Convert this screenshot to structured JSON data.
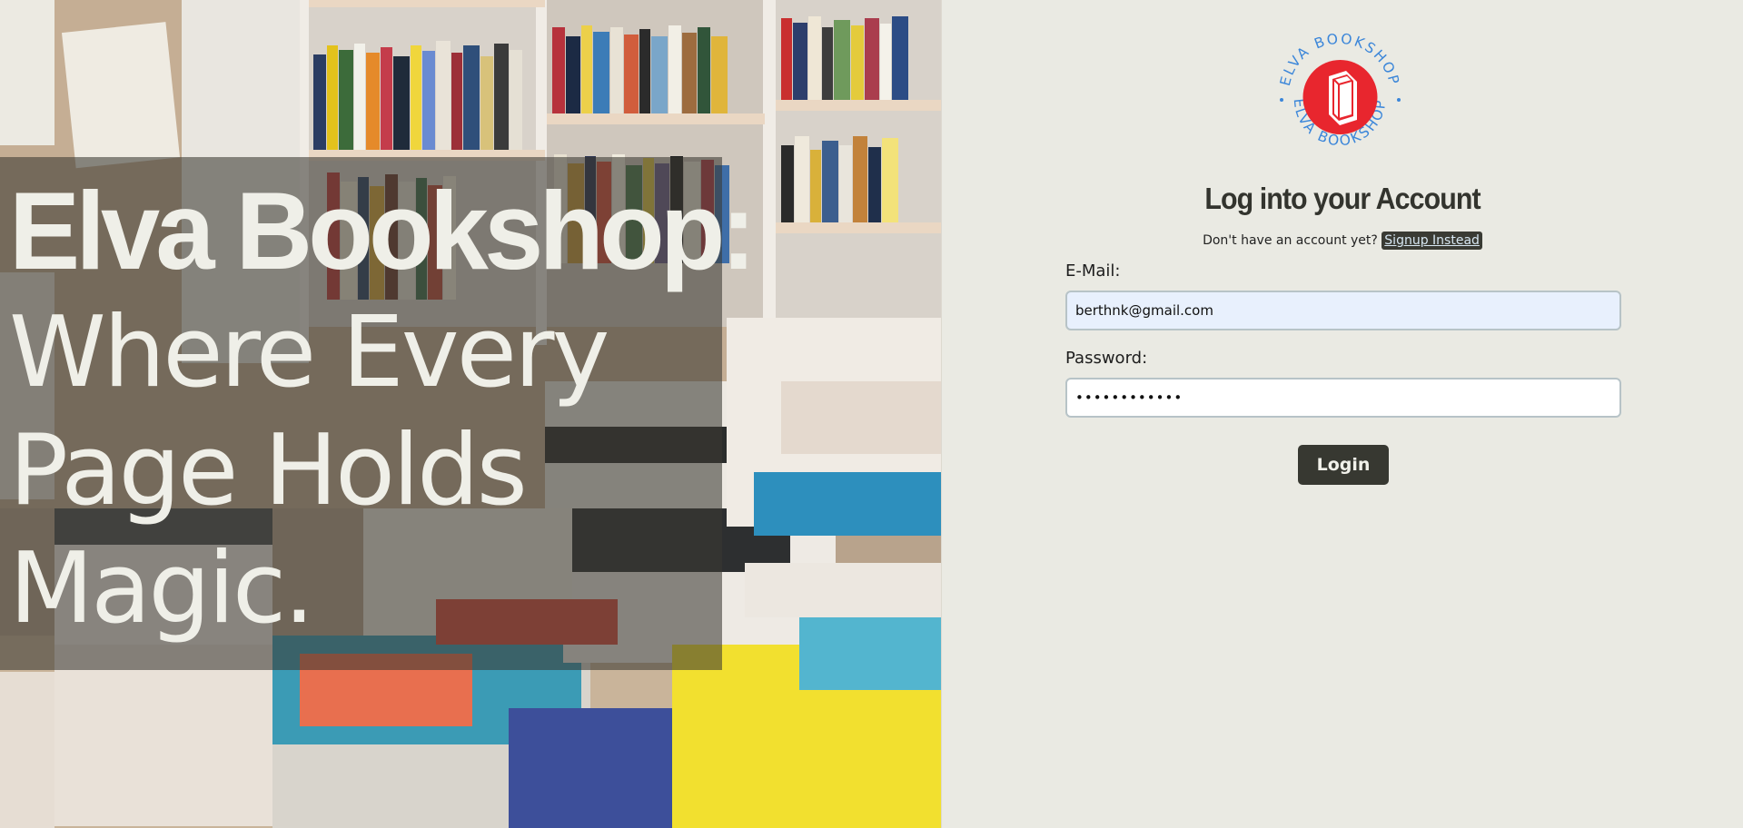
{
  "hero": {
    "brand": "Elva Bookshop:",
    "tagline": "Where Every Page Holds Magic."
  },
  "logo": {
    "ring_text_top": "ELVA BOOKSHOP",
    "ring_text_bottom": "ELVA BOOKSHOP",
    "icon": "book-icon",
    "ring_color": "#3b86d9",
    "badge_color": "#e8262e"
  },
  "login": {
    "title": "Log into your Account",
    "signup_prompt": "Don't have an account yet?",
    "signup_link": "Signup Instead",
    "email_label": "E-Mail:",
    "email_value": "berthnk@gmail.com",
    "password_label": "Password:",
    "password_value": "••••••••••••",
    "submit_label": "Login"
  },
  "colors": {
    "panel_bg": "#eaeae3",
    "button_bg": "#373831",
    "title_color": "#33342e"
  }
}
